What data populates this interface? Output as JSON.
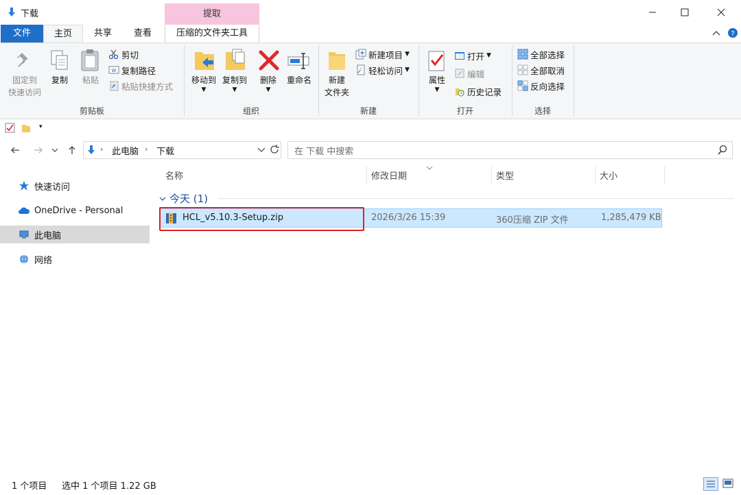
{
  "window": {
    "title": "下载",
    "contextual_header": "提取"
  },
  "tabs": {
    "file": "文件",
    "home": "主页",
    "share": "共享",
    "view": "查看",
    "zip_tools": "压缩的文件夹工具"
  },
  "ribbon": {
    "clipboard": {
      "label": "剪贴板",
      "pin_line1": "固定到",
      "pin_line2": "快速访问",
      "copy": "复制",
      "paste": "粘贴",
      "cut": "剪切",
      "copy_path": "复制路径",
      "paste_shortcut": "粘贴快捷方式"
    },
    "organize": {
      "label": "组织",
      "move_to": "移动到",
      "copy_to": "复制到",
      "delete": "删除",
      "rename": "重命名"
    },
    "new": {
      "label": "新建",
      "new_folder_line1": "新建",
      "new_folder_line2": "文件夹",
      "new_item": "新建项目",
      "easy_access": "轻松访问"
    },
    "open": {
      "label": "打开",
      "properties": "属性",
      "open": "打开",
      "edit": "编辑",
      "history": "历史记录"
    },
    "select": {
      "label": "选择",
      "select_all": "全部选择",
      "select_none": "全部取消",
      "invert": "反向选择"
    }
  },
  "address": {
    "crumb1": "此电脑",
    "crumb2": "下载",
    "search_placeholder": "在 下载 中搜索"
  },
  "nav": {
    "quick_access": "快速访问",
    "onedrive": "OneDrive - Personal",
    "this_pc": "此电脑",
    "network": "网络"
  },
  "columns": {
    "name": "名称",
    "modified": "修改日期",
    "type": "类型",
    "size": "大小"
  },
  "group": {
    "header": "今天 (1)"
  },
  "file": {
    "name": "HCL_v5.10.3-Setup.zip",
    "modified": "2026/3/26 15:39",
    "type": "360压缩 ZIP 文件",
    "size": "1,285,479 KB"
  },
  "status": {
    "count": "1 个项目",
    "selection": "选中 1 个项目  1.22 GB"
  },
  "colors": {
    "file_tab": "#1f6fc9",
    "contextual": "#f7c5dd",
    "selection": "#cce8ff",
    "highlight": "#e02020"
  }
}
